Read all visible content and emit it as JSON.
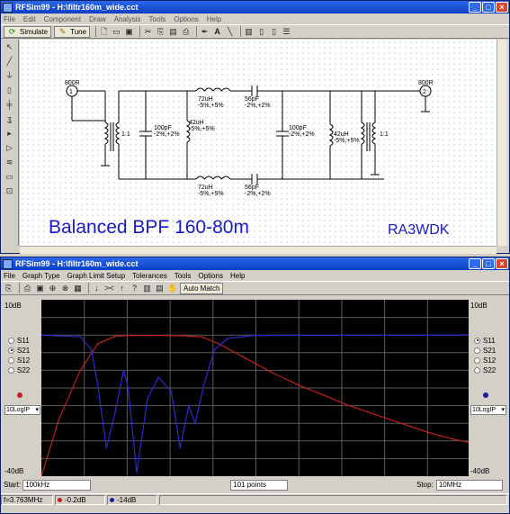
{
  "schematic_window": {
    "title": "RFSim99 - H:\\filtr160m_wide.cct",
    "menu": [
      "File",
      "Edit",
      "Component",
      "Draw",
      "Analysis",
      "Tools",
      "Options",
      "Help"
    ],
    "toolbar": {
      "simulate_label": "Simulate",
      "tune_label": "Tune"
    },
    "ports": [
      {
        "label": "800R",
        "number": "1"
      },
      {
        "label": "800R",
        "number": "2"
      }
    ],
    "components": {
      "xfmr_ratio_1": "1:1",
      "xfmr_ratio_2": "1:1",
      "c_shunt_1": "100pF\n-2%,+2%",
      "c_shunt_2": "100pF\n-2%,+2%",
      "l_series_top": "72uH\n-5%,+5%",
      "l_series_bottom": "72uH\n-5%,+5%",
      "c_series_top": "56pF\n-2%,+2%",
      "c_series_bottom": "56pF\n-2%,+2%",
      "l_shunt_1": "42uH\n-5%,+5%",
      "l_shunt_2": "42uH\n-5%,+5%"
    },
    "caption": "Balanced BPF 160-80m",
    "author": "RA3WDK"
  },
  "graph_window": {
    "title": "RFSim99 - H:\\filtr160m_wide.cct",
    "menu": [
      "File",
      "Graph Type",
      "Graph Limit Setup",
      "Tolerances",
      "Tools",
      "Options",
      "Help"
    ],
    "toolbar": {
      "auto_match_label": "Auto Match"
    },
    "left_panel": {
      "top_scale": "10dB",
      "bottom_scale": "-40dB",
      "params": [
        "S11",
        "S21",
        "S12",
        "S22"
      ],
      "selected": "S21",
      "marker_color": "#c0201f",
      "format": "10LogIP"
    },
    "right_panel": {
      "top_scale": "10dB",
      "bottom_scale": "-40dB",
      "params": [
        "S11",
        "S21",
        "S12",
        "S22"
      ],
      "selected": "S11",
      "marker_color": "#1a1aa8",
      "format": "10LogIP"
    },
    "start_label": "Start:",
    "start_value": "100kHz",
    "points_value": "101 points",
    "stop_label": "Stop:",
    "stop_value": "10MHz",
    "status": {
      "freq": "f=3.763MHz",
      "val1": "-0.2dB",
      "val2": "-14dB"
    }
  },
  "chart_data": {
    "type": "line",
    "title": "",
    "xlabel": "",
    "ylabel": "",
    "xlim_MHz": [
      0.1,
      10
    ],
    "ylim": [
      -40,
      10
    ],
    "grid": true,
    "series": [
      {
        "axis": "left",
        "color": "#c0201f",
        "x": [
          0.1,
          0.5,
          1.0,
          1.4,
          1.8,
          2.2,
          2.6,
          3.0,
          3.4,
          3.8,
          4.2,
          4.8,
          5.4,
          6.0,
          6.6,
          7.2,
          7.8,
          8.4,
          9.0,
          9.6,
          10.0
        ],
        "values": [
          -40,
          -24,
          -10,
          -2.5,
          -0.3,
          -0.1,
          -0.1,
          -0.1,
          -0.2,
          -0.5,
          -2.5,
          -6.5,
          -10.5,
          -14,
          -17,
          -20,
          -22.5,
          -25,
          -27.5,
          -29.5,
          -30.5
        ]
      },
      {
        "axis": "right",
        "color": "#2a2ad0",
        "x": [
          0.1,
          1.0,
          1.25,
          1.4,
          1.6,
          1.8,
          2.0,
          2.1,
          2.3,
          2.55,
          2.8,
          3.1,
          3.3,
          3.5,
          3.65,
          3.85,
          4.1,
          4.4,
          5.0,
          10.0
        ],
        "values": [
          0,
          -0.5,
          -4,
          -14,
          -32,
          -22,
          -10,
          -15,
          -39,
          -18,
          -12,
          -16,
          -32,
          -20,
          -25,
          -14,
          -4,
          -1,
          -0.1,
          0
        ]
      }
    ]
  }
}
